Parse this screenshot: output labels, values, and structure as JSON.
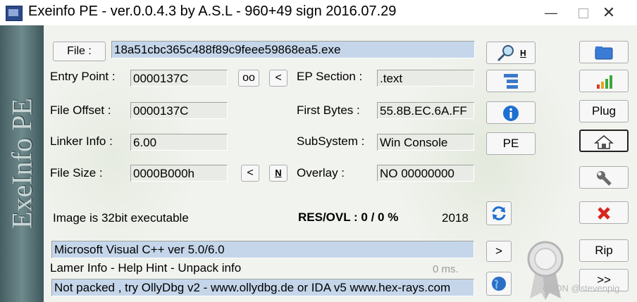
{
  "window": {
    "title": "Exeinfo PE - ver.0.0.4.3  by A.S.L -  960+49 sign  2016.07.29",
    "minimize": "—",
    "maximize": "☐",
    "close": "✕"
  },
  "sidebar": {
    "logo_text": "ExeInfo PE"
  },
  "file": {
    "button_label": "File :",
    "value": "18a51cbc365c488f89c9feee59868ea5.exe"
  },
  "fields": {
    "entry_point_label": "Entry Point :",
    "entry_point": "0000137C",
    "oo_button": "oo",
    "lt_button": "<",
    "ep_section_label": "EP Section :",
    "ep_section": ".text",
    "file_offset_label": "File Offset :",
    "file_offset": "0000137C",
    "first_bytes_label": "First Bytes :",
    "first_bytes": "55.8B.EC.6A.FF",
    "linker_info_label": "Linker Info :",
    "linker_info": "6.00",
    "subsystem_label": "SubSystem :",
    "subsystem": "Win Console",
    "file_size_label": "File Size :",
    "file_size": "0000B000h",
    "size_lt_button": "<",
    "size_n_button": "N",
    "overlay_label": "Overlay :",
    "overlay": "NO  00000000"
  },
  "info": {
    "image_type": "Image is 32bit executable",
    "res_ovl": "RES/OVL : 0 / 0 %",
    "year": "2018",
    "compiler": "Microsoft Visual C++ ver 5.0/6.0",
    "lamer_info": "Lamer Info - Help Hint - Unpack info",
    "time": "0 ms.",
    "hint": "Not packed , try OllyDbg v2 - www.ollydbg.de or IDA v5 www.hex-rays.com"
  },
  "middle_buttons": {
    "search_h": "H",
    "pe_label": "PE",
    "arrow_label": ">"
  },
  "right_buttons": {
    "plug_label": "Plug",
    "rip_label": "Rip",
    "more_label": ">>"
  },
  "watermark": "CSDN @stevenpig",
  "colors": {
    "field_blue": "#c5d6ea",
    "sidebar": "#5b7578",
    "background": "#f1f3ee"
  }
}
